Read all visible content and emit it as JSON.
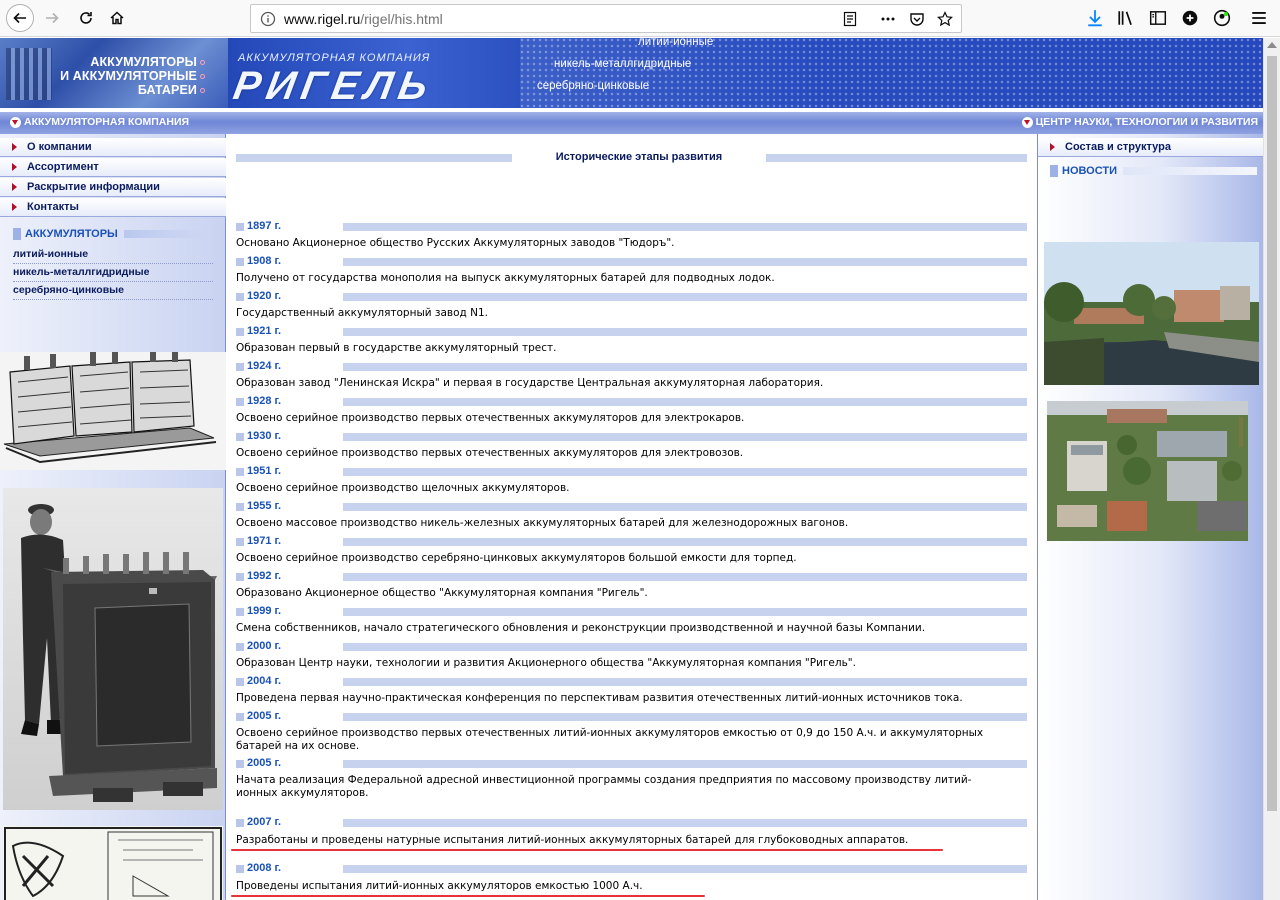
{
  "browser": {
    "url_host": "www.rigel.ru",
    "url_path": "/rigel/his.html"
  },
  "banner": {
    "left_lines": [
      "АККУМУЛЯТОРЫ",
      "И АККУМУЛЯТОРНЫЕ",
      "БАТАРЕИ"
    ],
    "company_caption": "АККУМУЛЯТОРНАЯ КОМПАНИЯ",
    "logo": "РИГЕЛЬ",
    "tech_lines": [
      "литий-ионные",
      "никель-металлгидридные",
      "серебряно-цинковые"
    ]
  },
  "subbar": {
    "left": "АККУМУЛЯТОРНАЯ КОМПАНИЯ",
    "right": "ЦЕНТР НАУКИ, ТЕХНОЛОГИИ И РАЗВИТИЯ"
  },
  "left_menu": [
    "О компании",
    "Ассортимент",
    "Раскрытие информации",
    "Контакты"
  ],
  "left_section": {
    "title": "АККУМУЛЯТОРЫ",
    "links": [
      "литий-ионные",
      "никель-металлгидридные",
      "серебряно-цинковые"
    ]
  },
  "main": {
    "title": "Исторические этапы развития",
    "events": [
      {
        "year": "1897 г.",
        "text": "Основано Акционерное общество Русских Аккумуляторных заводов \"Тюдоръ\"."
      },
      {
        "year": "1908 г.",
        "text": "Получено от государства монополия на выпуск аккумуляторных батарей для подводных лодок."
      },
      {
        "year": "1920 г.",
        "text": "Государственный аккумуляторный завод N1."
      },
      {
        "year": "1921 г.",
        "text": "Образован первый в государстве аккумуляторный трест."
      },
      {
        "year": "1924 г.",
        "text": "Образован завод \"Ленинская Искра\" и первая в государстве Центральная аккумуляторная лаборатория."
      },
      {
        "year": "1928 г.",
        "text": "Освоено серийное производство первых отечественных аккумуляторов для электрокаров."
      },
      {
        "year": "1930 г.",
        "text": "Освоено серийное производство первых отечественных аккумуляторов для электровозов."
      },
      {
        "year": "1951 г.",
        "text": "Освоено серийное производство щелочных аккумуляторов."
      },
      {
        "year": "1955 г.",
        "text": "Освоено массовое производство никель-железных аккумуляторных батарей для железнодорожных вагонов."
      },
      {
        "year": "1971 г.",
        "text": "Освоено серийное производство серебряно-цинковых аккумуляторов большой емкости для торпед."
      },
      {
        "year": "1992 г.",
        "text": "Образовано Акционерное общество \"Аккумуляторная компания \"Ригель\"."
      },
      {
        "year": "1999 г.",
        "text": "Смена собственников, начало стратегического обновления и реконструкции производственной и научной базы Компании."
      },
      {
        "year": "2000 г.",
        "text": "Образован Центр науки, технологии и развития Акционерного общества \"Аккумуляторная компания \"Ригель\"."
      },
      {
        "year": "2004 г.",
        "text": "Проведена первая научно-практическая конференция по перспективам развития отечественных литий-ионных источников тока."
      },
      {
        "year": "2005 г.",
        "text": "Освоено серийное производство первых отечественных литий-ионных аккумуляторов емкостью от 0,9 до 150 А.ч. и аккумуляторных батарей на их основе."
      },
      {
        "year": "2005 г.",
        "text": "Начата реализация Федеральной адресной инвестиционной программы создания предприятия по массовому производству литий-ионных аккумуляторов."
      },
      {
        "year": "2007 г.",
        "text": "Разработаны и проведены натурные испытания литий-ионных аккумуляторных батарей для глубоководных аппаратов."
      },
      {
        "year": "2008 г.",
        "text": "Проведены испытания литий-ионных аккумуляторов емкостью 1000 А.ч."
      }
    ]
  },
  "right_menu": [
    "Состав и структура"
  ],
  "right_section": {
    "title": "НОВОСТИ"
  },
  "colors": {
    "banner_blue": "#2a55cc",
    "link_blue": "#1a52b8",
    "menu_text": "#0a1b5e",
    "annotation_red": "#e8323c",
    "bar_light": "#c7d2ee"
  }
}
